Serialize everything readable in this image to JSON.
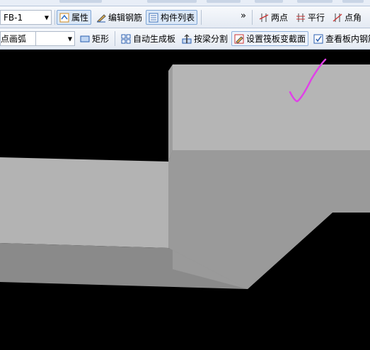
{
  "toolbar1": {
    "combo_value": "FB-1",
    "attributes_label": "属性",
    "edit_rebar_label": "编辑钢筋",
    "component_list_label": "构件列表",
    "overflow_label": "»",
    "two_points_label": "两点",
    "parallel_label": "平行",
    "point_angle_label": "点角"
  },
  "toolbar2": {
    "arc_combo_value": "点画弧",
    "rectangle_label": "矩形",
    "auto_generate_label": "自动生成板",
    "split_by_beam_label": "按梁分割",
    "set_section_change_label": "设置筏板变截面",
    "view_rebar_label": "查看板内钢筋"
  },
  "colors": {
    "annotation": "#e040e8",
    "slab_top": "#b3b3b3",
    "slab_front": "#8a8a8a",
    "slab_side": "#999999"
  }
}
